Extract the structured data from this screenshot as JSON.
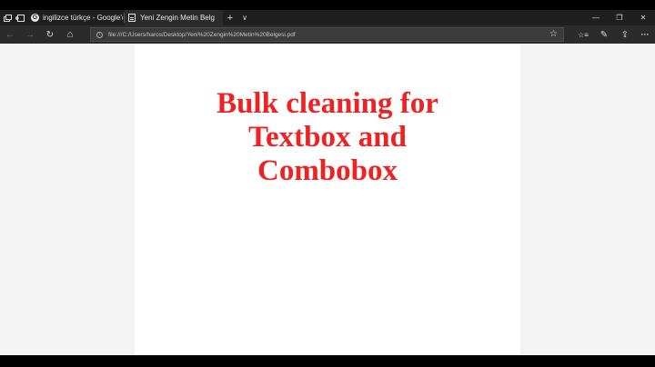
{
  "browser": {
    "tabs": [
      {
        "title": "ingilizce türkçe - Google'da",
        "favicon": "google-favicon"
      },
      {
        "title": "Yeni Zengin Metin Belg",
        "favicon": "pdf-file-icon"
      }
    ],
    "new_tab_symbol": "+",
    "tab_list_symbol": "∨",
    "window_controls": {
      "minimize": "—",
      "restore": "❐",
      "close": "✕"
    }
  },
  "navigation": {
    "back": "←",
    "forward": "→",
    "refresh": "↻",
    "home": "⌂",
    "url": "file:///C:/Users/haros/Desktop/Yeni%20Zengin%20Metin%20Belgesi.pdf",
    "favorite": "☆",
    "hub": "☆≡",
    "notes": "✎",
    "share": "⇪",
    "more": "···"
  },
  "document": {
    "title_lines": [
      "Bulk cleaning for",
      "Textbox and",
      "Combobox"
    ]
  }
}
